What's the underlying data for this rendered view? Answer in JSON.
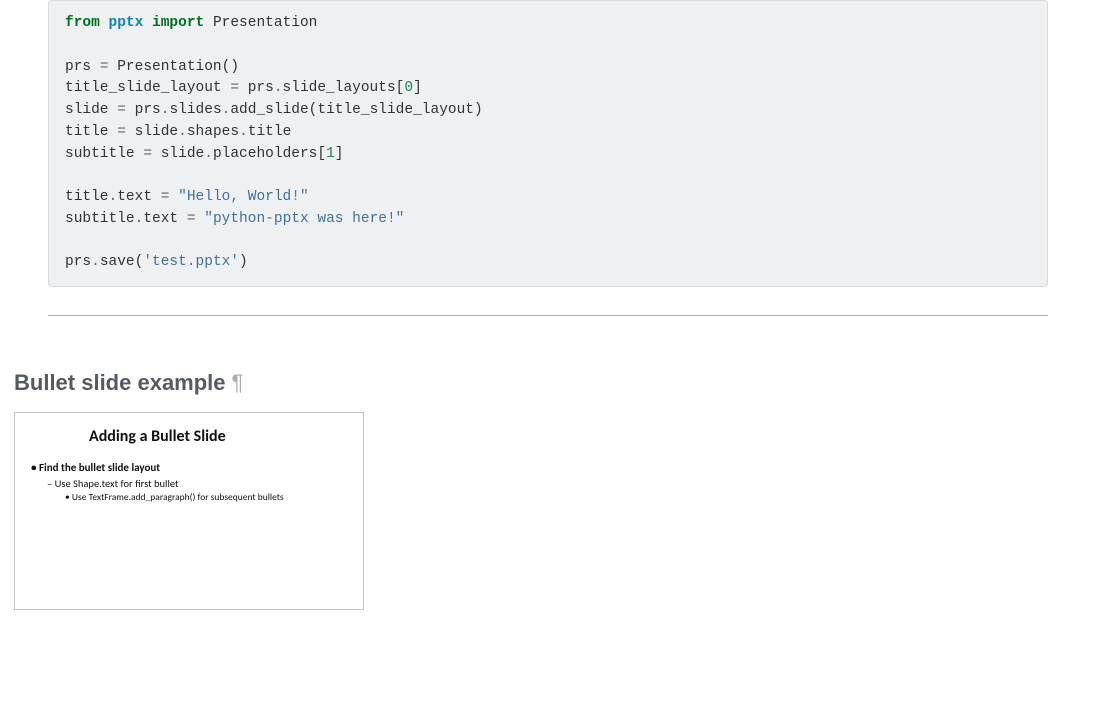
{
  "code": {
    "from": "from",
    "pkg": "pptx",
    "import": "import",
    "presentation": "Presentation",
    "line2a": "prs ",
    "eq": "=",
    "line2b": " Presentation()",
    "line3a": "title_slide_layout ",
    "line3b": " prs",
    "dot": ".",
    "line3c": "slide_layouts[",
    "zero": "0",
    "line3d": "]",
    "line4a": "slide ",
    "line4b": " prs",
    "line4c": "slides",
    "line4d": "add_slide(title_slide_layout)",
    "line5a": "title ",
    "line5b": " slide",
    "line5c": "shapes",
    "line5d": "title",
    "line6a": "subtitle ",
    "line6b": " slide",
    "line6c": "placeholders[",
    "one": "1",
    "line6d": "]",
    "line7a": "title",
    "line7b": "text ",
    "str1": "\"Hello, World!\"",
    "line8a": "subtitle",
    "line8b": "text ",
    "str2": "\"python-pptx was here!\"",
    "line9a": "prs",
    "line9b": "save(",
    "str3": "'test.pptx'",
    "line9c": ")"
  },
  "section": {
    "heading": "Bullet slide example",
    "pilcrow": "¶"
  },
  "slide": {
    "title": "Adding a Bullet Slide",
    "b1": "Find the bullet slide layout",
    "b2": "Use Shape.text for first bullet",
    "b3": "Use TextFrame.add_paragraph() for subsequent bullets"
  }
}
